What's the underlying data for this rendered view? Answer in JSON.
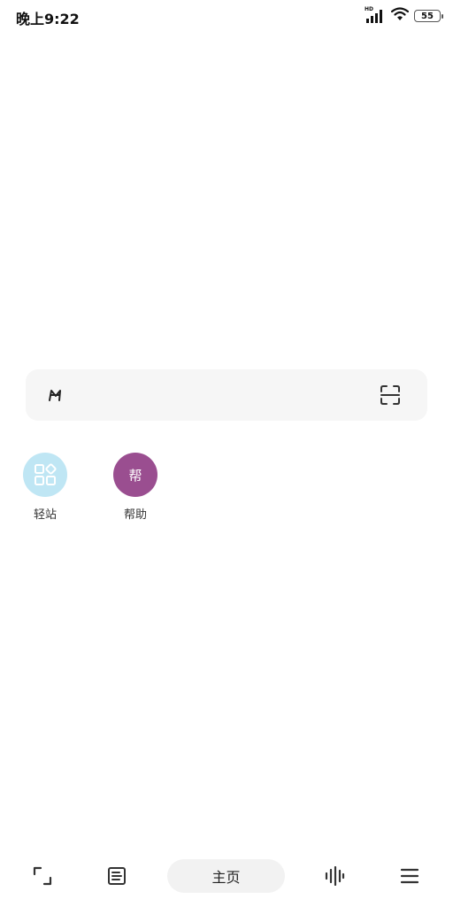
{
  "status_bar": {
    "time": "晚上9:22",
    "network_label": "HD",
    "battery_level": "55"
  },
  "search": {
    "engine_icon": "engine-logo-icon",
    "scan_icon": "scan-icon"
  },
  "shortcuts": [
    {
      "label": "轻站",
      "icon": "grid-apps-icon",
      "color": "#bfe6f4"
    },
    {
      "label": "帮助",
      "glyph": "帮",
      "color": "#9a4e90"
    }
  ],
  "bottom_nav": {
    "home_label": "主页",
    "icons": [
      "fullscreen-icon",
      "reader-icon",
      "voice-wave-icon",
      "menu-icon"
    ]
  }
}
